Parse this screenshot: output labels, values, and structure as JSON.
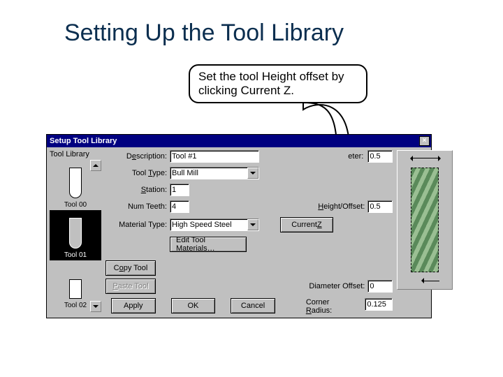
{
  "slide": {
    "title": "Setting Up the Tool Library",
    "callout": "Set the tool Height offset by clicking Current Z."
  },
  "window": {
    "title": "Setup Tool Library",
    "close": "×"
  },
  "sidebar": {
    "label": "Tool Library",
    "items": [
      {
        "name": "Tool 00"
      },
      {
        "name": "Tool 01"
      },
      {
        "name": "Tool 02"
      }
    ]
  },
  "fields": {
    "description_label": "Description:",
    "description_value": "Tool #1",
    "tooltype_label": "Tool Type:",
    "tooltype_value": "Bull Mill",
    "station_label": "Station:",
    "station_value": "1",
    "numteeth_label": "Num Teeth:",
    "numteeth_value": "4",
    "material_label": "Material Type:",
    "material_value": "High Speed Steel",
    "diameter_label_suffix": "eter:",
    "diameter_value": "0.5",
    "heightoffset_label": "Height/Offset:",
    "heightoffset_value": "0.5",
    "diameteroffset_label": "Diameter Offset:",
    "diameteroffset_value": "0",
    "cornerradius_label_prefix": "Corner",
    "cornerradius_label_suffix": "adius:",
    "cornerradius_value": "0.125"
  },
  "buttons": {
    "edit_materials": "Edit Tool Materials…",
    "copy_tool": "Copy Tool",
    "paste_tool": "Paste Tool",
    "apply": "Apply",
    "ok": "OK",
    "cancel": "Cancel",
    "current_z": "Current Z"
  }
}
